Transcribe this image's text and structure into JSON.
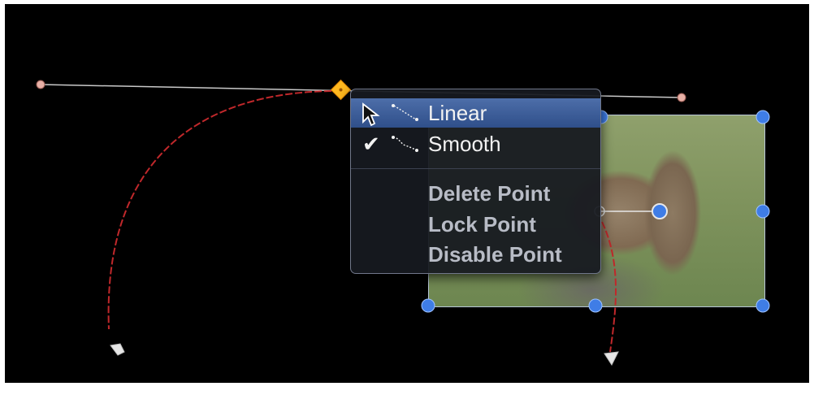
{
  "context_menu": {
    "items": [
      {
        "label": "Linear",
        "selected": true,
        "checked": false,
        "glyph": "linear-curve-icon"
      },
      {
        "label": "Smooth",
        "selected": false,
        "checked": true,
        "glyph": "smooth-curve-icon"
      },
      {
        "label": "Delete Point"
      },
      {
        "label": "Lock Point"
      },
      {
        "label": "Disable Point"
      }
    ],
    "check_mark": "✔"
  },
  "colors": {
    "canvas": "#000000",
    "menu_highlight": "#3a5a97",
    "motion_path": "#c0282b",
    "control_point": "#ffb81f",
    "handle": "#3f7de6"
  }
}
